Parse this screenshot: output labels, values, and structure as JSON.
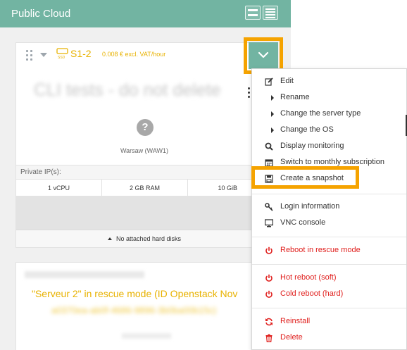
{
  "header": {
    "title": "Public Cloud"
  },
  "server_card": {
    "name": "S1-2",
    "price": "0.008 € excl. VAT/hour",
    "blurred_title": "CLI tests - do not delete",
    "region": "Warsaw (WAW1)",
    "help_glyph": "?",
    "private_ip_label": "Private IP(s):",
    "specs": [
      "1 vCPU",
      "2 GB RAM",
      "10 GiB"
    ],
    "disks_footer": "No attached hard disks"
  },
  "server_card_2": {
    "rescue_message": "\"Serveur 2\" in rescue mode (ID Openstack Nov",
    "rescue_id_blurred": "a0370ea-ab0f-4686-9896-3b0ba00b15c)"
  },
  "menu": {
    "items": [
      {
        "label": "Edit",
        "icon": "edit-icon"
      },
      {
        "label": "Rename",
        "icon": "triangle-right-icon"
      },
      {
        "label": "Change the server type",
        "icon": "triangle-right-icon"
      },
      {
        "label": "Change the OS",
        "icon": "triangle-right-icon"
      },
      {
        "label": "Display monitoring",
        "icon": "search-icon"
      },
      {
        "label": "Switch to monthly subscription",
        "icon": "calendar-icon"
      },
      {
        "label": "Create a snapshot",
        "icon": "save-icon"
      },
      {
        "label": "Login information",
        "icon": "key-icon"
      },
      {
        "label": "VNC console",
        "icon": "monitor-icon"
      },
      {
        "label": "Reboot in rescue mode",
        "icon": "power-icon"
      },
      {
        "label": "Hot reboot (soft)",
        "icon": "power-icon"
      },
      {
        "label": "Cold reboot (hard)",
        "icon": "power-icon"
      },
      {
        "label": "Reinstall",
        "icon": "refresh-icon"
      },
      {
        "label": "Delete",
        "icon": "trash-icon"
      }
    ]
  },
  "colors": {
    "accent": "#72b4a2",
    "highlight": "#f5a300",
    "warning_text": "#e8b200",
    "danger": "#e0201e"
  }
}
